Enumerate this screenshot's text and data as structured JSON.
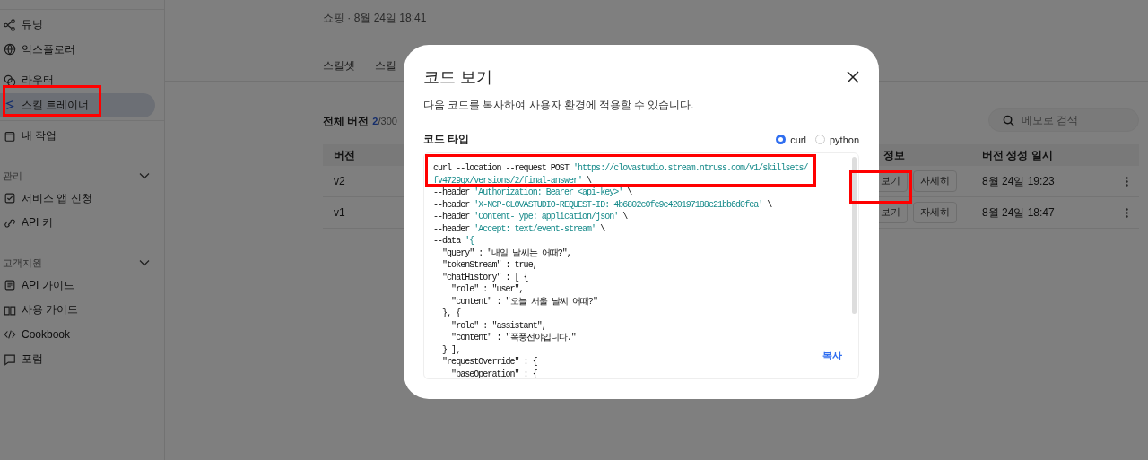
{
  "sidebar": {
    "sections": [
      {
        "items": [
          {
            "label": "튜닝",
            "selected": false
          },
          {
            "label": "익스플로러",
            "selected": false
          }
        ]
      },
      {
        "items": [
          {
            "label": "라우터",
            "selected": false
          },
          {
            "label": "스킬 트레이너",
            "selected": true
          }
        ]
      },
      {
        "items": [
          {
            "label": "내 작업",
            "selected": false
          }
        ]
      },
      {
        "title": "관리",
        "expanded": true,
        "items": [
          {
            "label": "서비스 앱 신청",
            "selected": false
          },
          {
            "label": "API 키",
            "selected": false
          }
        ]
      },
      {
        "title": "고객지원",
        "expanded": true,
        "items": [
          {
            "label": "API 가이드",
            "selected": false
          },
          {
            "label": "사용 가이드",
            "selected": false
          },
          {
            "label": "Cookbook",
            "selected": false
          },
          {
            "label": "포럼",
            "selected": false
          }
        ]
      }
    ]
  },
  "main": {
    "breadcrumb": "쇼핑 · 8월 24일 18:41",
    "tabs": [
      {
        "label": "스킬셋",
        "selected": false
      },
      {
        "label": "스킬",
        "selected": false
      }
    ],
    "versions": {
      "title": "전체 버전",
      "count": "2",
      "total": "/300"
    },
    "search": {
      "placeholder": "메모로 검색"
    },
    "table": {
      "columns": [
        "버전",
        "정보",
        "버전 생성 일시"
      ],
      "rows": [
        {
          "version": "v2",
          "buttons": [
            "보기",
            "자세히"
          ],
          "created": "8월 24일 19:23"
        },
        {
          "version": "v1",
          "buttons": [
            "보기",
            "자세히"
          ],
          "created": "8월 24일 18:47"
        }
      ]
    }
  },
  "dialog": {
    "title": "코드 보기",
    "description": "다음 코드를 복사하여 사용자 환경에 적용할 수 있습니다.",
    "code_type_label": "코드 타입",
    "options": [
      {
        "label": "curl",
        "selected": true
      },
      {
        "label": "python",
        "selected": false
      }
    ],
    "code_lines": [
      [
        {
          "kind": "plain",
          "text": "curl --location --request POST "
        },
        {
          "kind": "string",
          "text": "'https://clovastudio.stream.ntruss.com/v1/skillsets/"
        }
      ],
      [
        {
          "kind": "string",
          "text": "fv4729qx/versions/2/final-answer'"
        },
        {
          "kind": "plain",
          "text": " \\"
        }
      ],
      [
        {
          "kind": "plain",
          "text": "--header "
        },
        {
          "kind": "string",
          "text": "'Authorization: Bearer <api-key>'"
        },
        {
          "kind": "plain",
          "text": " \\"
        }
      ],
      [
        {
          "kind": "plain",
          "text": "--header "
        },
        {
          "kind": "string",
          "text": "'X-NCP-CLOVASTUDIO-REQUEST-ID: 4b6802c0fe9e420197188e21bb6d0fea'"
        },
        {
          "kind": "plain",
          "text": " \\"
        }
      ],
      [
        {
          "kind": "plain",
          "text": "--header "
        },
        {
          "kind": "string",
          "text": "'Content-Type: application/json'"
        },
        {
          "kind": "plain",
          "text": " \\"
        }
      ],
      [
        {
          "kind": "plain",
          "text": "--header "
        },
        {
          "kind": "string",
          "text": "'Accept: text/event-stream'"
        },
        {
          "kind": "plain",
          "text": " \\"
        }
      ],
      [
        {
          "kind": "plain",
          "text": "--data "
        },
        {
          "kind": "string",
          "text": "'{"
        }
      ],
      [
        {
          "kind": "plain",
          "text": "  \"query\" : \"내일 날씨는 어때?\","
        }
      ],
      [
        {
          "kind": "plain",
          "text": "  \"tokenStream\" : true,"
        }
      ],
      [
        {
          "kind": "plain",
          "text": "  \"chatHistory\" : [ {"
        }
      ],
      [
        {
          "kind": "plain",
          "text": "    \"role\" : \"user\","
        }
      ],
      [
        {
          "kind": "plain",
          "text": "    \"content\" : \"오늘 서울 날씨 어때?\""
        }
      ],
      [
        {
          "kind": "plain",
          "text": "  }, {"
        }
      ],
      [
        {
          "kind": "plain",
          "text": "    \"role\" : \"assistant\","
        }
      ],
      [
        {
          "kind": "plain",
          "text": "    \"content\" : \"폭풍전야입니다.\""
        }
      ],
      [
        {
          "kind": "plain",
          "text": "  } ],"
        }
      ],
      [
        {
          "kind": "plain",
          "text": "  \"requestOverride\" : {"
        }
      ],
      [
        {
          "kind": "plain",
          "text": "    \"baseOperation\" : {"
        }
      ]
    ],
    "copy_button": "복사"
  }
}
